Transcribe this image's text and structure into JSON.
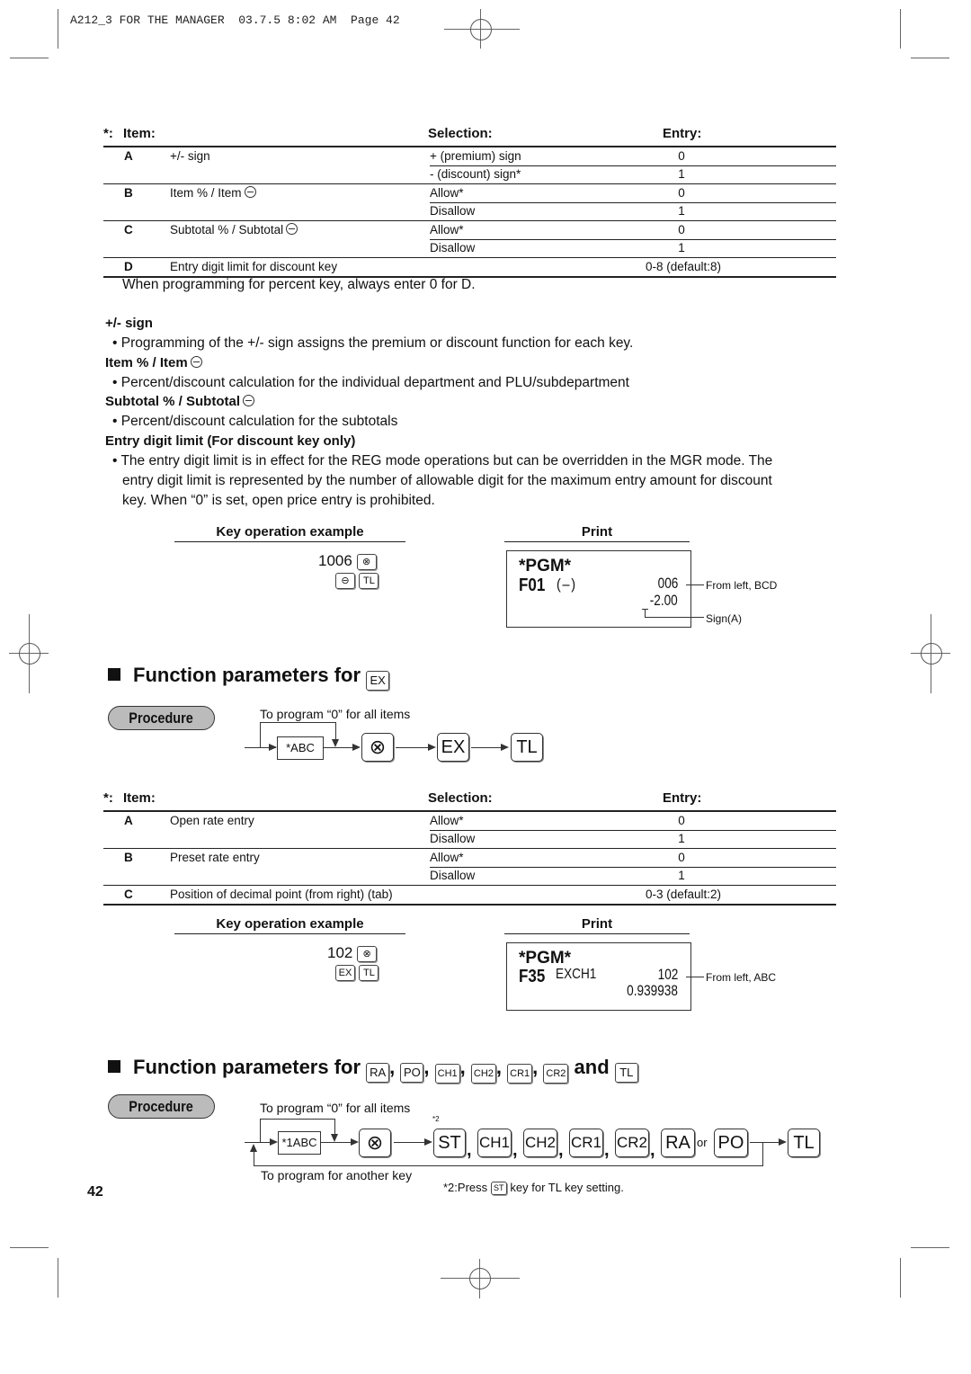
{
  "print_header": "A212_3 FOR THE MANAGER  03.7.5 8:02 AM  Page 42",
  "table1": {
    "prefix": "*:",
    "headers": {
      "item": "Item:",
      "selection": "Selection:",
      "entry": "Entry:"
    },
    "rows": [
      {
        "letter": "A",
        "item": "+/- sign",
        "options": [
          {
            "selection": "+ (premium) sign",
            "entry": "0"
          },
          {
            "selection": "- (discount) sign*",
            "entry": "1"
          }
        ]
      },
      {
        "letter": "B",
        "item": "Item % / Item",
        "options": [
          {
            "selection": "Allow*",
            "entry": "0"
          },
          {
            "selection": "Disallow",
            "entry": "1"
          }
        ]
      },
      {
        "letter": "C",
        "item": "Subtotal % / Subtotal",
        "options": [
          {
            "selection": "Allow*",
            "entry": "0"
          },
          {
            "selection": "Disallow",
            "entry": "1"
          }
        ]
      },
      {
        "letter": "D",
        "item": "Entry digit limit for discount key",
        "entry": "0-8 (default:8)"
      }
    ],
    "footnote": "When programming for percent key, always enter 0 for D."
  },
  "notes": {
    "sign_title": "+/- sign",
    "sign_text": "• Programming of the +/- sign assigns the premium or discount function for each key.",
    "item_title": "Item % / Item",
    "item_text": "• Percent/discount calculation for the individual department and PLU/subdepartment",
    "subtotal_title": "Subtotal % / Subtotal",
    "subtotal_text": "• Percent/discount calculation for the subtotals",
    "limit_title": "Entry digit limit (For discount key only)",
    "limit_text_1": "• The entry digit limit is in effect for the REG mode operations but can be overridden in the MGR mode.  The",
    "limit_text_2": "entry digit limit is represented by the number of allowable digit for the maximum entry amount for discount",
    "limit_text_3": "key.  When “0” is set, open price entry is prohibited."
  },
  "example1": {
    "key_op_title": "Key operation example",
    "print_title": "Print",
    "key_line1_num": "1006",
    "key_tl": "TL",
    "receipt": {
      "pgm": "*PGM*",
      "code": "F01",
      "label": "(–)",
      "value1": "006",
      "value2": "-2.00"
    },
    "annotation1": "From left, BCD",
    "annotation2": "Sign(A)"
  },
  "section_ex": {
    "title": "Function parameters for",
    "key": "EX",
    "procedure_label": "Procedure",
    "loop_label": "To program “0” for all items",
    "abc_label": "*ABC",
    "keys": [
      "EX",
      "TL"
    ]
  },
  "table2": {
    "prefix": "*:",
    "headers": {
      "item": "Item:",
      "selection": "Selection:",
      "entry": "Entry:"
    },
    "rows": [
      {
        "letter": "A",
        "item": "Open rate entry",
        "options": [
          {
            "selection": "Allow*",
            "entry": "0"
          },
          {
            "selection": "Disallow",
            "entry": "1"
          }
        ]
      },
      {
        "letter": "B",
        "item": "Preset rate entry",
        "options": [
          {
            "selection": "Allow*",
            "entry": "0"
          },
          {
            "selection": "Disallow",
            "entry": "1"
          }
        ]
      },
      {
        "letter": "C",
        "item": "Position of decimal point (from right) (tab)",
        "entry": "0-3 (default:2)"
      }
    ]
  },
  "example2": {
    "key_op_title": "Key operation example",
    "print_title": "Print",
    "key_line1_num": "102",
    "key_ex": "EX",
    "key_tl": "TL",
    "receipt": {
      "pgm": "*PGM*",
      "code": "F35",
      "label": "EXCH1",
      "value1": "102",
      "value2": "0.939938"
    },
    "annotation1": "From left, ABC"
  },
  "section_keys": {
    "title": "Function parameters for",
    "keys": [
      "RA",
      "PO",
      "CH1",
      "CH2",
      "CR1",
      "CR2"
    ],
    "and": "and",
    "last_key": "TL",
    "procedure_label": "Procedure",
    "loop_label": "To program  “0” for all items",
    "abc_label": "*1ABC",
    "superscript": "*2",
    "flow_keys": [
      "ST",
      "CH1",
      "CH2",
      "CR1",
      "CR2",
      "RA"
    ],
    "or": "or",
    "po": "PO",
    "tl": "TL",
    "return_label": "To program for another key",
    "footnote_prefix": "*2:Press",
    "footnote_key": "ST",
    "footnote_suffix": "key for TL key setting."
  },
  "page_number": "42"
}
